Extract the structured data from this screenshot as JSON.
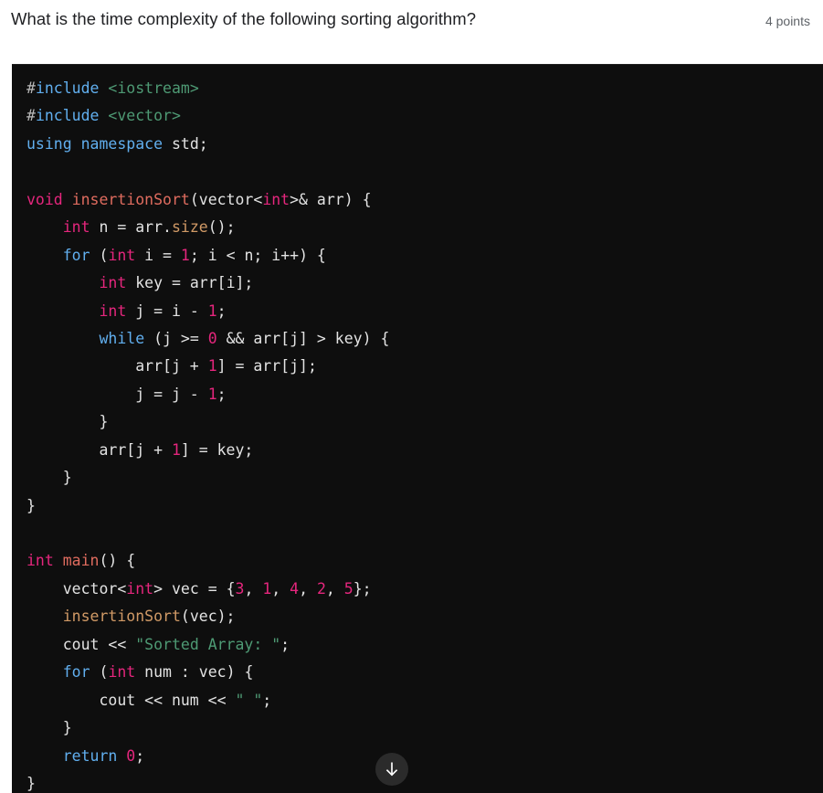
{
  "question": {
    "title": "What is the time complexity of the following sorting algorithm?",
    "points_label": "4 points"
  },
  "code_block": {
    "language": "cpp",
    "background_color": "#0e0e0e",
    "palette": {
      "keyword": "#61afef",
      "type": "#e5267d",
      "string": "#4e9a74",
      "function_declaration": "#e06c5f",
      "function_call": "#d19a66",
      "number": "#e5267d",
      "plain": "#e3e3e3",
      "preprocessor_hash": "#b9b9b9"
    },
    "lines": [
      [
        {
          "t": "#",
          "c": "hash"
        },
        {
          "t": "include",
          "c": "kw"
        },
        {
          "t": " ",
          "c": "plain"
        },
        {
          "t": "<iostream>",
          "c": "str"
        }
      ],
      [
        {
          "t": "#",
          "c": "hash"
        },
        {
          "t": "include",
          "c": "kw"
        },
        {
          "t": " ",
          "c": "plain"
        },
        {
          "t": "<vector>",
          "c": "str"
        }
      ],
      [
        {
          "t": "using namespace",
          "c": "kw"
        },
        {
          "t": " std;",
          "c": "plain"
        }
      ],
      [],
      [
        {
          "t": "void",
          "c": "type"
        },
        {
          "t": " ",
          "c": "plain"
        },
        {
          "t": "insertionSort",
          "c": "fndecl"
        },
        {
          "t": "(vector<",
          "c": "plain"
        },
        {
          "t": "int",
          "c": "type"
        },
        {
          "t": ">& arr) {",
          "c": "plain"
        }
      ],
      [
        {
          "t": "    ",
          "c": "plain"
        },
        {
          "t": "int",
          "c": "type"
        },
        {
          "t": " n = arr.",
          "c": "plain"
        },
        {
          "t": "size",
          "c": "fncall"
        },
        {
          "t": "();",
          "c": "plain"
        }
      ],
      [
        {
          "t": "    ",
          "c": "plain"
        },
        {
          "t": "for",
          "c": "kw"
        },
        {
          "t": " (",
          "c": "plain"
        },
        {
          "t": "int",
          "c": "type"
        },
        {
          "t": " i = ",
          "c": "plain"
        },
        {
          "t": "1",
          "c": "num"
        },
        {
          "t": "; i < n; i++) {",
          "c": "plain"
        }
      ],
      [
        {
          "t": "        ",
          "c": "plain"
        },
        {
          "t": "int",
          "c": "type"
        },
        {
          "t": " key = arr[i];",
          "c": "plain"
        }
      ],
      [
        {
          "t": "        ",
          "c": "plain"
        },
        {
          "t": "int",
          "c": "type"
        },
        {
          "t": " j = i - ",
          "c": "plain"
        },
        {
          "t": "1",
          "c": "num"
        },
        {
          "t": ";",
          "c": "plain"
        }
      ],
      [
        {
          "t": "        ",
          "c": "plain"
        },
        {
          "t": "while",
          "c": "kw"
        },
        {
          "t": " (j >= ",
          "c": "plain"
        },
        {
          "t": "0",
          "c": "num"
        },
        {
          "t": " && arr[j] > key) {",
          "c": "plain"
        }
      ],
      [
        {
          "t": "            arr[j + ",
          "c": "plain"
        },
        {
          "t": "1",
          "c": "num"
        },
        {
          "t": "] = arr[j];",
          "c": "plain"
        }
      ],
      [
        {
          "t": "            j = j - ",
          "c": "plain"
        },
        {
          "t": "1",
          "c": "num"
        },
        {
          "t": ";",
          "c": "plain"
        }
      ],
      [
        {
          "t": "        }",
          "c": "plain"
        }
      ],
      [
        {
          "t": "        arr[j + ",
          "c": "plain"
        },
        {
          "t": "1",
          "c": "num"
        },
        {
          "t": "] = key;",
          "c": "plain"
        }
      ],
      [
        {
          "t": "    }",
          "c": "plain"
        }
      ],
      [
        {
          "t": "}",
          "c": "plain"
        }
      ],
      [],
      [
        {
          "t": "int",
          "c": "type"
        },
        {
          "t": " ",
          "c": "plain"
        },
        {
          "t": "main",
          "c": "fndecl"
        },
        {
          "t": "() {",
          "c": "plain"
        }
      ],
      [
        {
          "t": "    vector<",
          "c": "plain"
        },
        {
          "t": "int",
          "c": "type"
        },
        {
          "t": "> vec = {",
          "c": "plain"
        },
        {
          "t": "3",
          "c": "num"
        },
        {
          "t": ", ",
          "c": "plain"
        },
        {
          "t": "1",
          "c": "num"
        },
        {
          "t": ", ",
          "c": "plain"
        },
        {
          "t": "4",
          "c": "num"
        },
        {
          "t": ", ",
          "c": "plain"
        },
        {
          "t": "2",
          "c": "num"
        },
        {
          "t": ", ",
          "c": "plain"
        },
        {
          "t": "5",
          "c": "num"
        },
        {
          "t": "};",
          "c": "plain"
        }
      ],
      [
        {
          "t": "    ",
          "c": "plain"
        },
        {
          "t": "insertionSort",
          "c": "fncall"
        },
        {
          "t": "(vec);",
          "c": "plain"
        }
      ],
      [
        {
          "t": "    cout << ",
          "c": "plain"
        },
        {
          "t": "\"Sorted Array: \"",
          "c": "str"
        },
        {
          "t": ";",
          "c": "plain"
        }
      ],
      [
        {
          "t": "    ",
          "c": "plain"
        },
        {
          "t": "for",
          "c": "kw"
        },
        {
          "t": " (",
          "c": "plain"
        },
        {
          "t": "int",
          "c": "type"
        },
        {
          "t": " num : vec) {",
          "c": "plain"
        }
      ],
      [
        {
          "t": "        cout << num << ",
          "c": "plain"
        },
        {
          "t": "\" \"",
          "c": "str"
        },
        {
          "t": ";",
          "c": "plain"
        }
      ],
      [
        {
          "t": "    }",
          "c": "plain"
        }
      ],
      [
        {
          "t": "    ",
          "c": "plain"
        },
        {
          "t": "return",
          "c": "kw"
        },
        {
          "t": " ",
          "c": "plain"
        },
        {
          "t": "0",
          "c": "num"
        },
        {
          "t": ";",
          "c": "plain"
        }
      ],
      [
        {
          "t": "}",
          "c": "plain"
        }
      ]
    ]
  },
  "scroll_down_button": {
    "icon": "arrow-down-icon",
    "background_color": "#2b2b2b",
    "icon_color": "#ffffff"
  }
}
